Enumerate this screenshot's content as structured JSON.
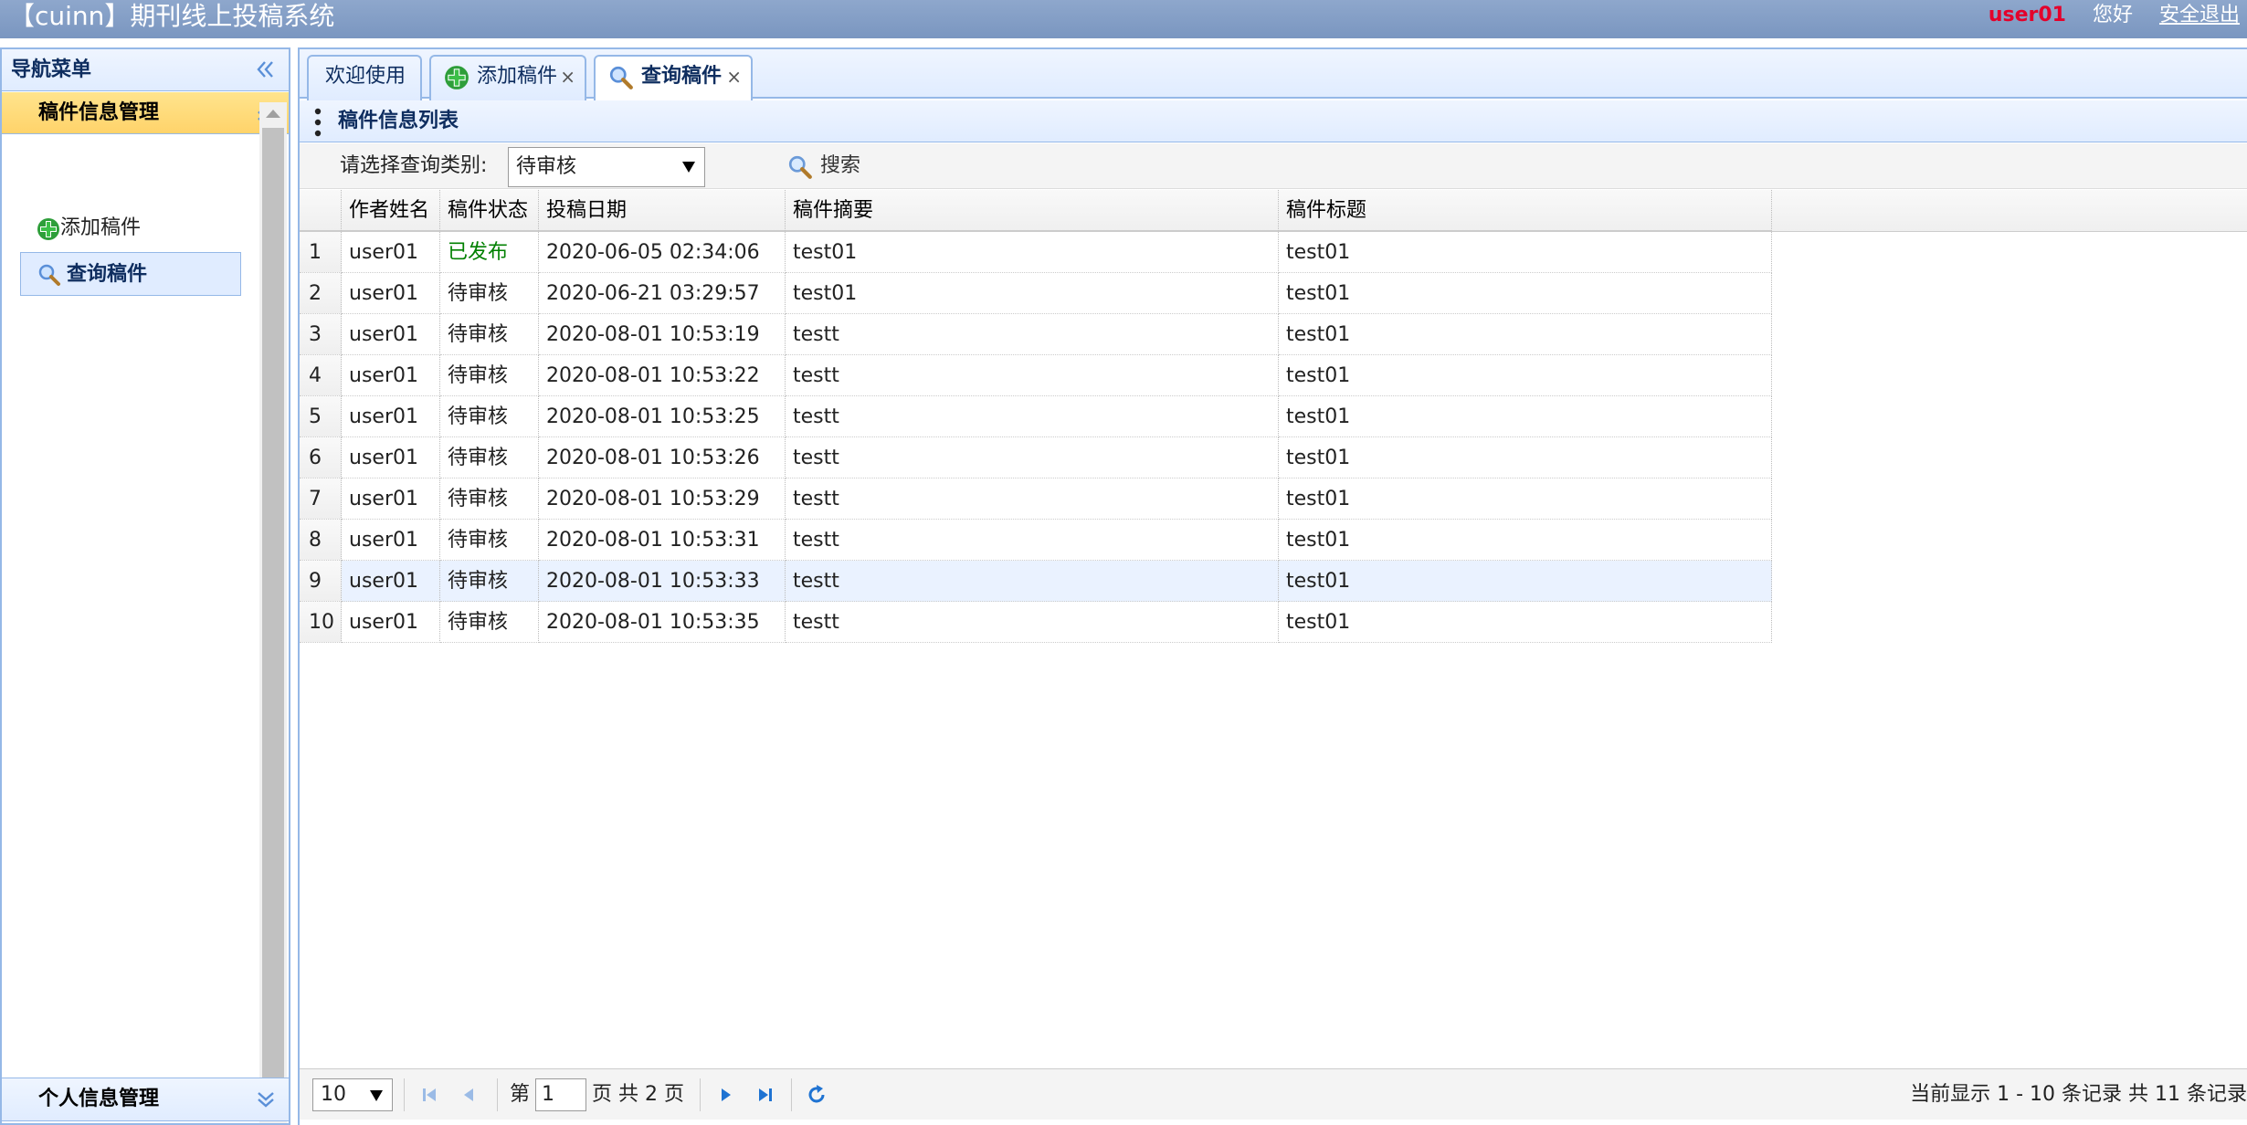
{
  "header": {
    "title": "【cuinn】期刊线上投稿系统",
    "user": "user01",
    "greeting": "您好",
    "logout": "安全退出"
  },
  "nav": {
    "title": "导航菜单",
    "sections": [
      {
        "label": "稿件信息管理"
      },
      {
        "label": "个人信息管理"
      }
    ],
    "items": [
      {
        "label": "添加稿件",
        "icon": "add-icon"
      },
      {
        "label": "查询稿件",
        "icon": "search-icon"
      }
    ]
  },
  "tabs": [
    {
      "label": "欢迎使用"
    },
    {
      "label": "添加稿件",
      "icon": "add-icon",
      "close": "×"
    },
    {
      "label": "查询稿件",
      "icon": "search-icon",
      "close": "×"
    }
  ],
  "panel": {
    "title": "稿件信息列表",
    "filter_label": "请选择查询类别:",
    "filter_value": "待审核",
    "search_label": "搜索"
  },
  "grid": {
    "columns": [
      "作者姓名",
      "稿件状态",
      "投稿日期",
      "稿件摘要",
      "稿件标题"
    ],
    "rows": [
      {
        "num": "1",
        "author": "user01",
        "status": "已发布",
        "date": "2020-06-05 02:34:06",
        "abstract": "test01",
        "title": "test01"
      },
      {
        "num": "2",
        "author": "user01",
        "status": "待审核",
        "date": "2020-06-21 03:29:57",
        "abstract": "test01",
        "title": "test01"
      },
      {
        "num": "3",
        "author": "user01",
        "status": "待审核",
        "date": "2020-08-01 10:53:19",
        "abstract": "testt",
        "title": "test01"
      },
      {
        "num": "4",
        "author": "user01",
        "status": "待审核",
        "date": "2020-08-01 10:53:22",
        "abstract": "testt",
        "title": "test01"
      },
      {
        "num": "5",
        "author": "user01",
        "status": "待审核",
        "date": "2020-08-01 10:53:25",
        "abstract": "testt",
        "title": "test01"
      },
      {
        "num": "6",
        "author": "user01",
        "status": "待审核",
        "date": "2020-08-01 10:53:26",
        "abstract": "testt",
        "title": "test01"
      },
      {
        "num": "7",
        "author": "user01",
        "status": "待审核",
        "date": "2020-08-01 10:53:29",
        "abstract": "testt",
        "title": "test01"
      },
      {
        "num": "8",
        "author": "user01",
        "status": "待审核",
        "date": "2020-08-01 10:53:31",
        "abstract": "testt",
        "title": "test01"
      },
      {
        "num": "9",
        "author": "user01",
        "status": "待审核",
        "date": "2020-08-01 10:53:33",
        "abstract": "testt",
        "title": "test01"
      },
      {
        "num": "10",
        "author": "user01",
        "status": "待审核",
        "date": "2020-08-01 10:53:35",
        "abstract": "testt",
        "title": "test01"
      }
    ]
  },
  "pager": {
    "page_size": "10",
    "page_prefix": "第",
    "page_value": "1",
    "page_suffix": "页 共 2 页",
    "info": "当前显示 1 - 10 条记录 共 11 条记录"
  },
  "colors": {
    "header_bg": "#7a96c0",
    "border": "#95b8e7",
    "accent_user": "#e4002b",
    "status_published": "#008000",
    "section_active": "#ffd36a"
  }
}
